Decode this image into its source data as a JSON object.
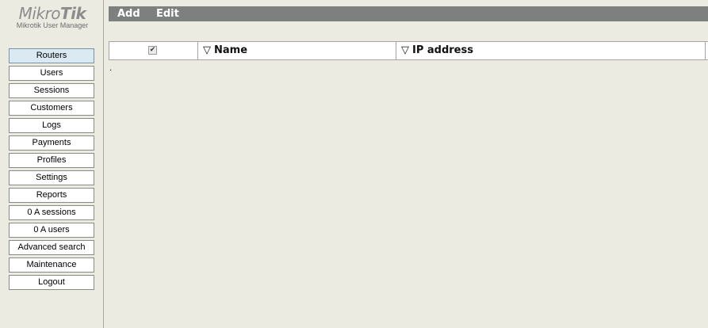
{
  "logo": {
    "brand_light": "Mikro",
    "brand_bold": "Tik",
    "subtitle": "Mikrotik User Manager"
  },
  "sidebar": {
    "items": [
      {
        "label": "Routers",
        "active": true
      },
      {
        "label": "Users"
      },
      {
        "label": "Sessions"
      },
      {
        "label": "Customers"
      },
      {
        "label": "Logs"
      },
      {
        "label": "Payments"
      },
      {
        "label": "Profiles"
      },
      {
        "label": "Settings"
      },
      {
        "label": "Reports"
      },
      {
        "label": "0 A sessions"
      },
      {
        "label": "0 A users"
      },
      {
        "label": "Advanced search"
      },
      {
        "label": "Maintenance"
      },
      {
        "label": "Logout"
      }
    ]
  },
  "toolbar": {
    "add_label": "Add",
    "edit_label": "Edit"
  },
  "table": {
    "sort_icon": "▽",
    "check_icon": "✔",
    "columns": [
      "Name",
      "IP address"
    ],
    "rows": [],
    "empty_marker": "."
  },
  "colors": {
    "background": "#ecebe2",
    "toolbar": "#7e8080",
    "active_item": "#dbe9f3"
  }
}
